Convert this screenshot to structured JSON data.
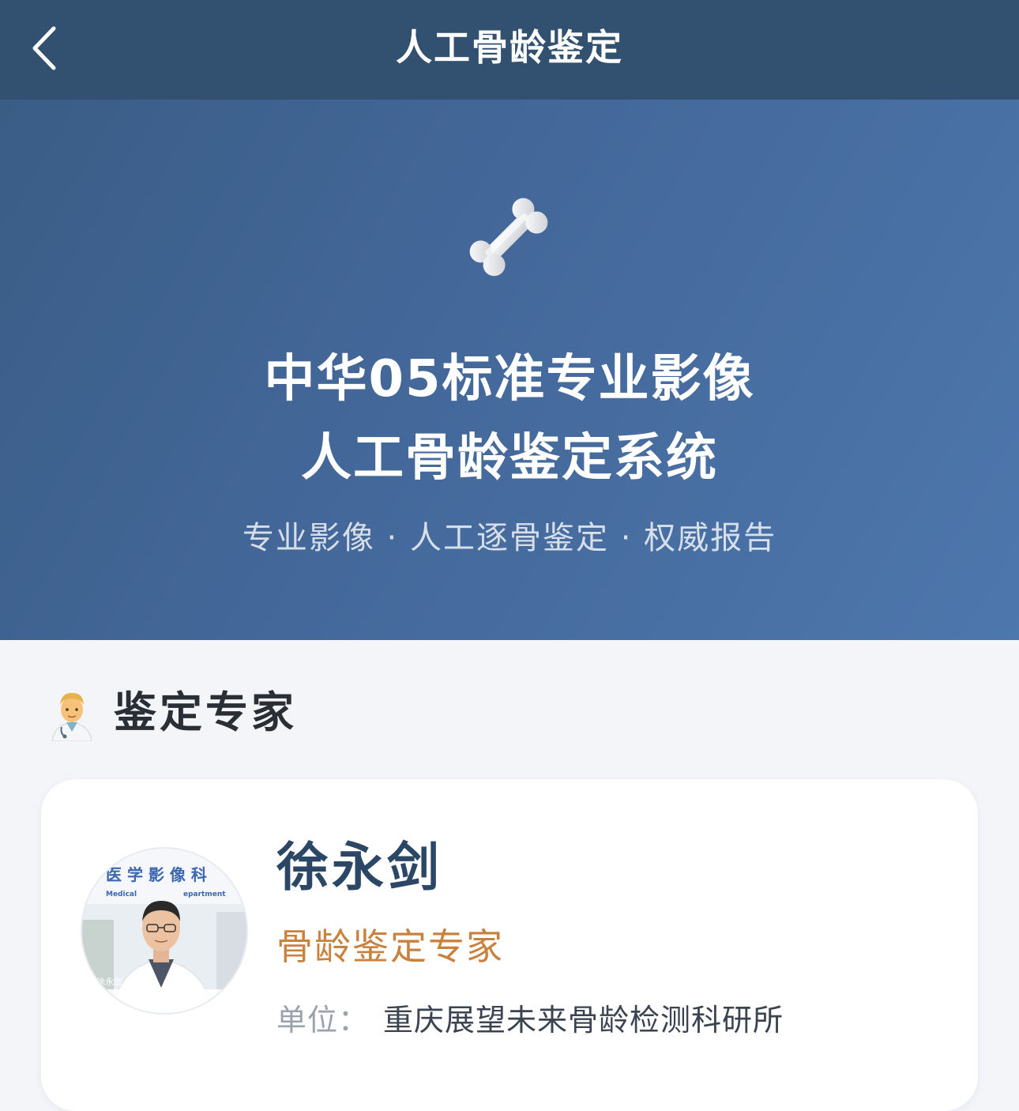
{
  "navbar": {
    "title": "人工骨龄鉴定",
    "back_icon": "chevron-left-icon"
  },
  "hero": {
    "icon": "bone-icon",
    "title_line1": "中华05标准专业影像",
    "title_line2": "人工骨龄鉴定系统",
    "subtitle": "专业影像 · 人工逐骨鉴定 · 权威报告"
  },
  "experts_section": {
    "icon": "doctor-icon",
    "title": "鉴定专家"
  },
  "expert": {
    "name": "徐永剑",
    "role": "骨龄鉴定专家",
    "unit_label": "单位：",
    "unit_value": "重庆展望未来骨龄检测科研所",
    "photo_sign_text": "医 学 影 像 科",
    "photo_sign_en_left": "Medical",
    "photo_sign_en_right": "epartment",
    "photo_caption": "徐永剑"
  },
  "colors": {
    "navbar_bg": "#32506f",
    "hero_bg_start": "#3a5d86",
    "hero_bg_end": "#4d77ad",
    "name_color": "#2c4766",
    "role_color": "#c9813e",
    "page_bg": "#f3f5f9"
  }
}
